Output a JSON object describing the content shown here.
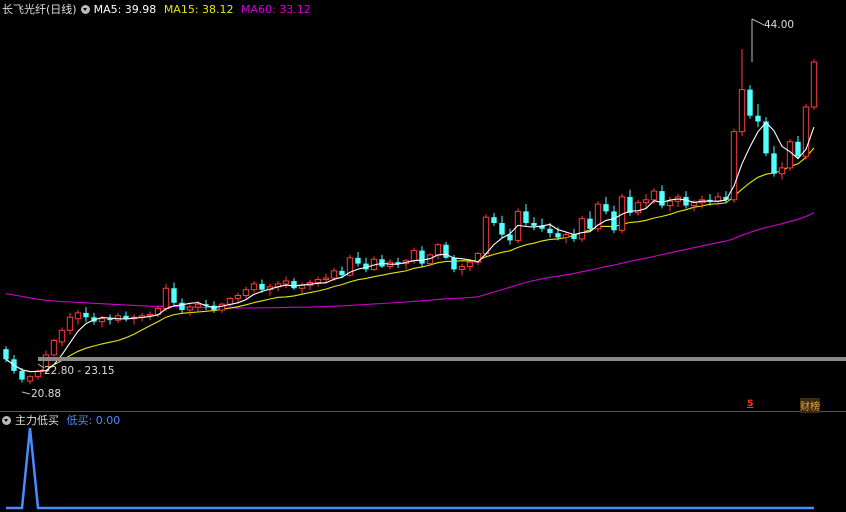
{
  "main_legend": {
    "title": "长飞光纤(日线)",
    "ma5_label": "MA5: 39.98",
    "ma15_label": "MA15: 38.12",
    "ma60_label": "MA60: 33.12"
  },
  "sub_legend": {
    "title": "主力低买",
    "value_label": "低买: 0.00"
  },
  "annotations": {
    "high": "44.00",
    "low": "20.88",
    "range": "22.80 - 23.15",
    "marker_s": "S",
    "marker_cb": "财榜"
  },
  "colors": {
    "up": "#ff3b3b",
    "down": "#54ffff",
    "ma5": "#ffffff",
    "ma15": "#e6e600",
    "ma60": "#d000d0",
    "indicator": "#4a8cff",
    "background": "#000000"
  },
  "chart_data": [
    {
      "type": "candlestick",
      "title": "长飞光纤(日线)",
      "ylim": [
        20,
        46
      ],
      "series": [
        {
          "name": "MA5",
          "value": 39.98
        },
        {
          "name": "MA15",
          "value": 38.12
        },
        {
          "name": "MA60",
          "value": 33.12
        }
      ],
      "annotations": [
        {
          "text": "44.00",
          "kind": "high"
        },
        {
          "text": "20.88",
          "kind": "low"
        },
        {
          "text": "22.80 - 23.15",
          "kind": "range"
        }
      ],
      "ohlc": [
        [
          23.3,
          23.5,
          22.4,
          22.6
        ],
        [
          22.6,
          22.9,
          21.6,
          21.8
        ],
        [
          21.8,
          22.0,
          21.0,
          21.2
        ],
        [
          21.1,
          21.5,
          20.88,
          21.4
        ],
        [
          21.4,
          21.9,
          21.2,
          21.8
        ],
        [
          21.8,
          23.2,
          21.7,
          22.9
        ],
        [
          22.9,
          24.0,
          22.8,
          23.9
        ],
        [
          23.8,
          24.8,
          23.5,
          24.6
        ],
        [
          24.6,
          25.8,
          24.3,
          25.5
        ],
        [
          25.4,
          26.0,
          25.0,
          25.8
        ],
        [
          25.8,
          26.2,
          25.2,
          25.5
        ],
        [
          25.5,
          25.8,
          25.0,
          25.2
        ],
        [
          25.2,
          25.6,
          24.8,
          25.4
        ],
        [
          25.4,
          25.7,
          25.0,
          25.3
        ],
        [
          25.3,
          25.8,
          25.1,
          25.6
        ],
        [
          25.6,
          25.9,
          25.2,
          25.4
        ],
        [
          25.4,
          25.7,
          25.0,
          25.5
        ],
        [
          25.5,
          25.8,
          25.2,
          25.6
        ],
        [
          25.6,
          25.9,
          25.3,
          25.7
        ],
        [
          25.7,
          26.3,
          25.5,
          26.1
        ],
        [
          26.1,
          27.8,
          25.9,
          27.5
        ],
        [
          27.5,
          27.9,
          26.3,
          26.5
        ],
        [
          26.5,
          26.8,
          25.8,
          26.0
        ],
        [
          26.0,
          26.4,
          25.6,
          26.2
        ],
        [
          26.2,
          26.6,
          25.9,
          26.4
        ],
        [
          26.4,
          26.7,
          26.0,
          26.3
        ],
        [
          26.3,
          26.6,
          25.8,
          26.0
        ],
        [
          26.0,
          26.5,
          25.8,
          26.4
        ],
        [
          26.4,
          26.9,
          26.2,
          26.8
        ],
        [
          26.8,
          27.2,
          26.5,
          27.0
        ],
        [
          27.0,
          27.6,
          26.8,
          27.4
        ],
        [
          27.4,
          28.0,
          27.2,
          27.8
        ],
        [
          27.8,
          28.1,
          27.2,
          27.4
        ],
        [
          27.4,
          27.8,
          27.0,
          27.6
        ],
        [
          27.6,
          28.0,
          27.3,
          27.8
        ],
        [
          27.8,
          28.3,
          27.5,
          28.0
        ],
        [
          28.0,
          28.2,
          27.4,
          27.5
        ],
        [
          27.5,
          27.9,
          27.1,
          27.7
        ],
        [
          27.7,
          28.1,
          27.4,
          27.9
        ],
        [
          27.9,
          28.3,
          27.6,
          28.1
        ],
        [
          28.1,
          28.5,
          27.8,
          28.2
        ],
        [
          28.2,
          28.9,
          28.0,
          28.7
        ],
        [
          28.7,
          29.0,
          28.2,
          28.4
        ],
        [
          28.4,
          29.8,
          28.3,
          29.6
        ],
        [
          29.6,
          30.0,
          29.0,
          29.2
        ],
        [
          29.2,
          29.6,
          28.6,
          28.8
        ],
        [
          28.8,
          29.7,
          28.7,
          29.5
        ],
        [
          29.5,
          29.8,
          28.9,
          29.0
        ],
        [
          29.0,
          29.5,
          28.8,
          29.3
        ],
        [
          29.3,
          29.6,
          28.9,
          29.2
        ],
        [
          29.2,
          29.5,
          28.8,
          29.4
        ],
        [
          29.4,
          30.3,
          29.2,
          30.1
        ],
        [
          30.1,
          30.4,
          29.0,
          29.2
        ],
        [
          29.2,
          29.9,
          29.0,
          29.8
        ],
        [
          29.8,
          30.6,
          29.5,
          30.5
        ],
        [
          30.5,
          30.7,
          29.5,
          29.6
        ],
        [
          29.6,
          29.8,
          28.6,
          28.8
        ],
        [
          28.8,
          29.2,
          28.4,
          29.0
        ],
        [
          29.0,
          29.5,
          28.7,
          29.3
        ],
        [
          29.3,
          30.0,
          29.1,
          29.9
        ],
        [
          29.9,
          32.6,
          29.7,
          32.4
        ],
        [
          32.4,
          32.7,
          31.8,
          32.0
        ],
        [
          32.0,
          32.5,
          31.0,
          31.2
        ],
        [
          31.2,
          31.6,
          30.5,
          30.8
        ],
        [
          30.8,
          33.0,
          30.6,
          32.8
        ],
        [
          32.8,
          33.3,
          31.8,
          32.0
        ],
        [
          32.0,
          32.4,
          31.5,
          31.8
        ],
        [
          31.8,
          32.3,
          31.4,
          31.6
        ],
        [
          31.6,
          32.0,
          31.0,
          31.3
        ],
        [
          31.3,
          31.7,
          30.8,
          31.0
        ],
        [
          31.0,
          31.4,
          30.6,
          31.2
        ],
        [
          31.2,
          31.6,
          30.7,
          30.9
        ],
        [
          30.9,
          32.5,
          30.7,
          32.3
        ],
        [
          32.3,
          32.8,
          31.4,
          31.6
        ],
        [
          31.6,
          33.5,
          31.4,
          33.3
        ],
        [
          33.3,
          33.8,
          32.6,
          32.8
        ],
        [
          32.8,
          33.2,
          31.3,
          31.5
        ],
        [
          31.5,
          34.0,
          31.3,
          33.8
        ],
        [
          33.8,
          34.3,
          32.5,
          32.7
        ],
        [
          32.7,
          33.6,
          32.5,
          33.4
        ],
        [
          33.4,
          34.0,
          33.0,
          33.6
        ],
        [
          33.6,
          34.4,
          33.3,
          34.2
        ],
        [
          34.2,
          34.6,
          33.0,
          33.2
        ],
        [
          33.2,
          33.8,
          32.8,
          33.5
        ],
        [
          33.5,
          34.0,
          33.1,
          33.8
        ],
        [
          33.8,
          34.2,
          33.0,
          33.2
        ],
        [
          33.2,
          33.6,
          32.8,
          33.4
        ],
        [
          33.4,
          33.9,
          33.0,
          33.6
        ],
        [
          33.6,
          34.0,
          33.2,
          33.5
        ],
        [
          33.5,
          34.1,
          33.2,
          33.8
        ],
        [
          33.8,
          34.2,
          33.4,
          33.6
        ],
        [
          33.6,
          38.5,
          33.4,
          38.3
        ],
        [
          38.3,
          44.0,
          38.0,
          41.2
        ],
        [
          41.2,
          41.5,
          39.2,
          39.4
        ],
        [
          39.4,
          40.2,
          38.6,
          39.0
        ],
        [
          39.0,
          39.3,
          36.6,
          36.8
        ],
        [
          36.8,
          37.3,
          35.2,
          35.4
        ],
        [
          35.4,
          36.2,
          35.0,
          35.8
        ],
        [
          35.8,
          37.8,
          35.6,
          37.6
        ],
        [
          37.6,
          38.0,
          36.4,
          36.6
        ],
        [
          36.6,
          40.2,
          36.4,
          40.0
        ],
        [
          40.0,
          43.3,
          39.8,
          43.1
        ]
      ]
    },
    {
      "type": "line",
      "title": "主力低买",
      "series": [
        {
          "name": "低买",
          "value": 0.0
        }
      ],
      "values": [
        0,
        0,
        0,
        1,
        0,
        0,
        0,
        0,
        0,
        0,
        0,
        0,
        0,
        0,
        0,
        0,
        0,
        0,
        0,
        0,
        0,
        0,
        0,
        0,
        0,
        0,
        0,
        0,
        0,
        0,
        0,
        0,
        0,
        0,
        0,
        0,
        0,
        0,
        0,
        0,
        0,
        0,
        0,
        0,
        0,
        0,
        0,
        0,
        0,
        0,
        0,
        0,
        0,
        0,
        0,
        0,
        0,
        0,
        0,
        0,
        0,
        0,
        0,
        0,
        0,
        0,
        0,
        0,
        0,
        0,
        0,
        0,
        0,
        0,
        0,
        0,
        0,
        0,
        0,
        0,
        0,
        0,
        0,
        0,
        0,
        0,
        0,
        0,
        0,
        0,
        0,
        0,
        0,
        0,
        0,
        0,
        0,
        0,
        0,
        0,
        0,
        0
      ]
    }
  ]
}
